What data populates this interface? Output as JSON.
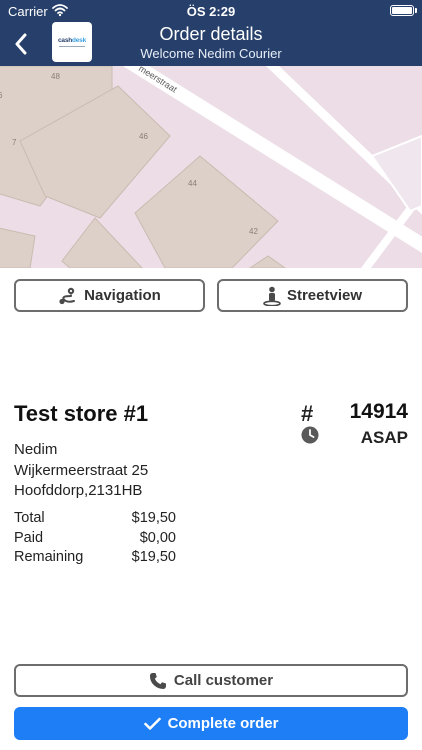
{
  "status_bar": {
    "carrier": "Carrier",
    "time": "ÖS 2:29",
    "wifi_icon": "wifi-icon",
    "battery_icon": "battery-icon"
  },
  "nav": {
    "title": "Order details",
    "subtitle": "Welcome  Nedim Courier",
    "back_icon": "chevron-left-icon",
    "logo": {
      "word_main": "cash",
      "word_accent": "desk"
    }
  },
  "map": {
    "street_label": "meerstraat",
    "house_numbers": [
      "48",
      "46",
      "44",
      "42",
      "7",
      "6"
    ]
  },
  "actions": {
    "navigation_label": "Navigation",
    "streetview_label": "Streetview"
  },
  "order": {
    "store_name": "Test store #1",
    "hash": "#",
    "number": "14914",
    "time": "ASAP",
    "customer": {
      "name": "Nedim",
      "street": "Wijkermeerstraat 25",
      "city_zip": "Hoofddorp,2131HB"
    },
    "totals": [
      {
        "label": "Total",
        "value": "$19,50"
      },
      {
        "label": "Paid",
        "value": "$0,00"
      },
      {
        "label": "Remaining",
        "value": "$19,50"
      }
    ]
  },
  "footer": {
    "call_label": "Call customer",
    "complete_label": "Complete order"
  },
  "colors": {
    "nav_bg": "#27406b",
    "primary": "#1e7ef5",
    "map_bg": "#ecdde6",
    "building": "#dcd0c8"
  }
}
